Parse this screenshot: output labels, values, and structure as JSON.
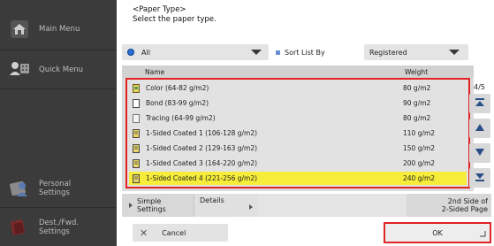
{
  "sidebar": {
    "items": [
      {
        "label": "Main Menu",
        "icon": "home-icon"
      },
      {
        "label": "Quick Menu",
        "icon": "quick-menu-icon"
      },
      {
        "label": "Personal\nSettings",
        "icon": "personal-settings-icon"
      },
      {
        "label": "Dest./Fwd.\nSettings",
        "icon": "dest-fwd-settings-icon"
      }
    ]
  },
  "header": {
    "title": "<Paper Type>",
    "subtitle": "Select the paper type."
  },
  "filter": {
    "category": "All",
    "sort_label": "Sort List By",
    "sort_value": "Registered"
  },
  "table": {
    "columns": [
      "Name",
      "Weight"
    ],
    "rows": [
      {
        "name": "Color (64-82 g/m2)",
        "weight": "80  g/m2",
        "icon": "color-paper-icon",
        "selected": false
      },
      {
        "name": "Bond (83-99 g/m2)",
        "weight": "90  g/m2",
        "icon": "paper-icon",
        "selected": false
      },
      {
        "name": "Tracing (64-99 g/m2)",
        "weight": "80  g/m2",
        "icon": "paper-icon",
        "selected": false
      },
      {
        "name": "1-Sided Coated 1 (106-128 g/m2)",
        "weight": "110 g/m2",
        "icon": "coated-paper-icon",
        "selected": false
      },
      {
        "name": "1-Sided Coated 2 (129-163 g/m2)",
        "weight": "150 g/m2",
        "icon": "coated-paper-icon",
        "selected": false
      },
      {
        "name": "1-Sided Coated 3 (164-220 g/m2)",
        "weight": "200 g/m2",
        "icon": "coated-paper-icon",
        "selected": false
      },
      {
        "name": "1-Sided Coated 4 (221-256 g/m2)",
        "weight": "240 g/m2",
        "icon": "coated-paper-icon",
        "selected": true
      }
    ]
  },
  "pagination": {
    "label": "4/5"
  },
  "options": {
    "simple_settings": "Simple\nSettings",
    "details": "Details",
    "second_side": "2nd Side of\n2-Sided Page"
  },
  "actions": {
    "cancel": "Cancel",
    "ok": "OK"
  },
  "colors": {
    "sidebar_bg": "#3b3b3b",
    "selected_row": "#f6ec3a",
    "highlight_border": "#e02424",
    "accent_blue": "#2a6fd6"
  }
}
